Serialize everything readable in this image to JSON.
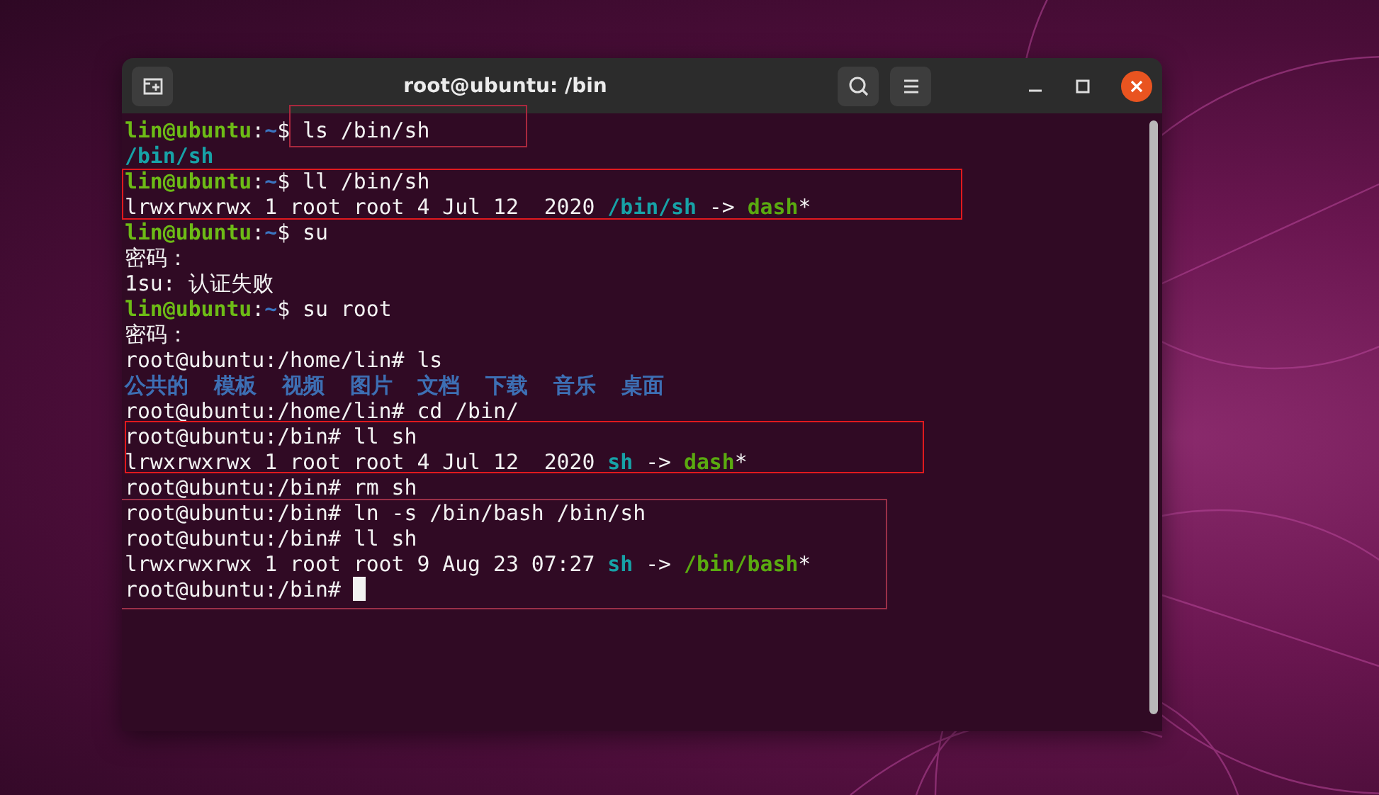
{
  "window": {
    "title": "root@ubuntu: /bin"
  },
  "terminal": {
    "groups": [
      {
        "framed": false,
        "lines": [
          {
            "segments": [
              {
                "kind": "user",
                "text": "lin@ubuntu"
              },
              {
                "kind": "text",
                "text": ":"
              },
              {
                "kind": "cwd",
                "text": "~"
              },
              {
                "kind": "text",
                "text": "$ "
              },
              {
                "kind": "text",
                "text": "ls /bin/sh",
                "framed": true,
                "color": "#a8283e"
              }
            ]
          },
          {
            "segments": [
              {
                "kind": "link",
                "text": "/bin/sh"
              }
            ]
          }
        ]
      },
      {
        "framed": true,
        "color": "#e0191e",
        "lines": [
          {
            "segments": [
              {
                "kind": "user",
                "text": "lin@ubuntu"
              },
              {
                "kind": "text",
                "text": ":"
              },
              {
                "kind": "cwd",
                "text": "~"
              },
              {
                "kind": "text",
                "text": "$ ll /bin/sh"
              }
            ]
          },
          {
            "segments": [
              {
                "kind": "text",
                "text": "lrwxrwxrwx 1 root root 4 Jul 12  2020 "
              },
              {
                "kind": "link",
                "text": "/bin/sh"
              },
              {
                "kind": "text",
                "text": " -> "
              },
              {
                "kind": "exec",
                "text": "dash"
              },
              {
                "kind": "text",
                "text": "*"
              }
            ]
          }
        ]
      },
      {
        "framed": false,
        "lines": [
          {
            "segments": [
              {
                "kind": "user",
                "text": "lin@ubuntu"
              },
              {
                "kind": "text",
                "text": ":"
              },
              {
                "kind": "cwd",
                "text": "~"
              },
              {
                "kind": "text",
                "text": "$ su"
              }
            ]
          },
          {
            "segments": [
              {
                "kind": "text",
                "text": "密码："
              }
            ]
          },
          {
            "segments": [
              {
                "kind": "text",
                "text": "1su: 认证失败"
              }
            ]
          },
          {
            "segments": [
              {
                "kind": "user",
                "text": "lin@ubuntu"
              },
              {
                "kind": "text",
                "text": ":"
              },
              {
                "kind": "cwd",
                "text": "~"
              },
              {
                "kind": "text",
                "text": "$ su root"
              }
            ]
          },
          {
            "segments": [
              {
                "kind": "text",
                "text": "密码："
              }
            ]
          },
          {
            "segments": [
              {
                "kind": "text",
                "text": "root@ubuntu:/home/lin# ls"
              }
            ]
          },
          {
            "segments": [
              {
                "kind": "dir",
                "text": "公共的  模板  视频  图片  文档  下载  音乐  桌面"
              }
            ]
          },
          {
            "segments": [
              {
                "kind": "text",
                "text": "root@ubuntu:/home/lin# cd /bin/"
              }
            ]
          }
        ]
      },
      {
        "framed": true,
        "color": "#e0191e",
        "lines": [
          {
            "segments": [
              {
                "kind": "text",
                "text": "root@ubuntu:/bin# ll sh"
              }
            ]
          },
          {
            "segments": [
              {
                "kind": "text",
                "text": "lrwxrwxrwx 1 root root 4 Jul 12  2020 "
              },
              {
                "kind": "link",
                "text": "sh"
              },
              {
                "kind": "text",
                "text": " -> "
              },
              {
                "kind": "exec",
                "text": "dash"
              },
              {
                "kind": "text",
                "text": "*"
              }
            ]
          }
        ]
      },
      {
        "framed": false,
        "lines": [
          {
            "segments": [
              {
                "kind": "text",
                "text": "root@ubuntu:/bin# rm sh"
              }
            ]
          }
        ]
      },
      {
        "framed": true,
        "color": "#9a2f48",
        "lines": [
          {
            "segments": [
              {
                "kind": "text",
                "text": "root@ubuntu:/bin# ln -s /bin/bash /bin/sh"
              }
            ]
          },
          {
            "segments": [
              {
                "kind": "text",
                "text": "root@ubuntu:/bin# ll sh"
              }
            ]
          },
          {
            "segments": [
              {
                "kind": "text",
                "text": "lrwxrwxrwx 1 root root 9 Aug 23 07:27 "
              },
              {
                "kind": "link",
                "text": "sh"
              },
              {
                "kind": "text",
                "text": " -> "
              },
              {
                "kind": "exec",
                "text": "/bin/bash"
              },
              {
                "kind": "text",
                "text": "*"
              }
            ]
          },
          {
            "segments": [
              {
                "kind": "text",
                "text": "root@ubuntu:/bin# "
              }
            ],
            "cursor": true
          }
        ]
      }
    ]
  }
}
